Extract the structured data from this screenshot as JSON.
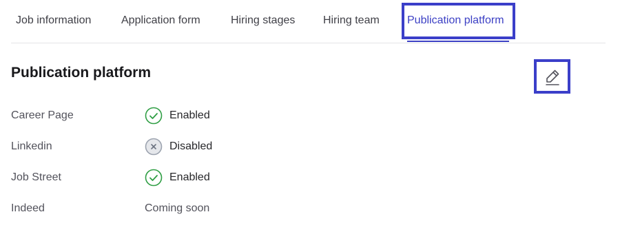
{
  "tabs": [
    {
      "label": "Job information",
      "active": false
    },
    {
      "label": "Application form",
      "active": false
    },
    {
      "label": "Hiring stages",
      "active": false
    },
    {
      "label": "Hiring team",
      "active": false
    },
    {
      "label": "Publication platform",
      "active": true
    }
  ],
  "section": {
    "title": "Publication platform",
    "edit_icon": "pencil-icon"
  },
  "platforms": [
    {
      "name": "Career Page",
      "status": "Enabled",
      "icon": "check-circle-icon"
    },
    {
      "name": "Linkedin",
      "status": "Disabled",
      "icon": "x-circle-icon"
    },
    {
      "name": "Job Street",
      "status": "Enabled",
      "icon": "check-circle-icon"
    },
    {
      "name": "Indeed",
      "status": "Coming soon",
      "icon": ""
    }
  ],
  "colors": {
    "accent": "#3b3fc4",
    "highlight": "#3b3fc9",
    "enabled": "#2f9e44",
    "disabled": "#9ca3af"
  }
}
